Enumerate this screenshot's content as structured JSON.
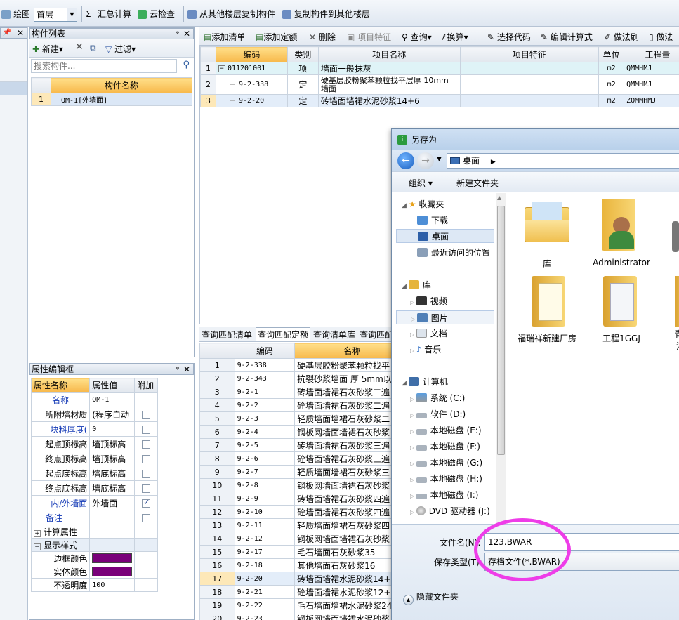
{
  "topbar": {
    "draw_label": "绘图",
    "floor": "首层",
    "sum_calc": "汇总计算",
    "cloud_check": "云检查",
    "copy_from": "从其他楼层复制构件",
    "copy_to": "复制构件到其他楼层"
  },
  "component_list": {
    "title": "构件列表",
    "new_label": "新建",
    "filter_label": "过滤",
    "search_placeholder": "搜索构件...",
    "col_name": "构件名称",
    "rows": [
      {
        "num": "1",
        "name": "QM-1[外墙面]"
      }
    ]
  },
  "quota_toolbar": {
    "add_list": "添加清单",
    "add_quota": "添加定额",
    "delete": "删除",
    "item_feature": "项目特征",
    "query": "查询",
    "convert": "换算",
    "select_code": "选择代码",
    "edit_formula": "编辑计算式",
    "method_brush": "做法刷",
    "method_q": "做法"
  },
  "quota_table": {
    "headers": [
      "编码",
      "类别",
      "项目名称",
      "项目特征",
      "单位",
      "工程量"
    ],
    "rows": [
      {
        "num": "1",
        "code": "011201001",
        "type": "项",
        "name": "墙面一般抹灰",
        "feature": "",
        "unit": "m2",
        "qty": "QMMHMJ"
      },
      {
        "num": "2",
        "code": "9-2-338",
        "type": "定",
        "name": "硬基层胶粉聚苯颗粒找平层厚 10mm 墙面",
        "feature": "",
        "unit": "m2",
        "qty": "QMMHMJ"
      },
      {
        "num": "3",
        "code": "9-2-20",
        "type": "定",
        "name": "砖墙面墙裙水泥砂浆14+6",
        "feature": "",
        "unit": "m2",
        "qty": "ZQMMHMJ"
      }
    ]
  },
  "query_tabs": [
    "查询匹配清单",
    "查询匹配定额",
    "查询清单库",
    "查询匹配"
  ],
  "query_table": {
    "headers": [
      "编码",
      "名称"
    ],
    "rows": [
      {
        "num": "1",
        "code": "9-2-338",
        "name": "硬基层胶粉聚苯颗粒找平"
      },
      {
        "num": "2",
        "code": "9-2-343",
        "name": "抗裂砂浆墙面 厚 5mm以内"
      },
      {
        "num": "3",
        "code": "9-2-1",
        "name": "砖墙面墙裙石灰砂浆二遍"
      },
      {
        "num": "4",
        "code": "9-2-2",
        "name": "砼墙面墙裙石灰砂浆二遍"
      },
      {
        "num": "5",
        "code": "9-2-3",
        "name": "轻质墙面墙裙石灰砂浆二"
      },
      {
        "num": "6",
        "code": "9-2-4",
        "name": "钢板网墙面墙裙石灰砂浆"
      },
      {
        "num": "7",
        "code": "9-2-5",
        "name": "砖墙面墙裙石灰砂浆三遍"
      },
      {
        "num": "8",
        "code": "9-2-6",
        "name": "砼墙面墙裙石灰砂浆三遍"
      },
      {
        "num": "9",
        "code": "9-2-7",
        "name": "轻质墙面墙裙石灰砂浆三"
      },
      {
        "num": "10",
        "code": "9-2-8",
        "name": "钢板网墙面墙裙石灰砂浆"
      },
      {
        "num": "11",
        "code": "9-2-9",
        "name": "砖墙面墙裙石灰砂浆四遍"
      },
      {
        "num": "12",
        "code": "9-2-10",
        "name": "砼墙面墙裙石灰砂浆四遍"
      },
      {
        "num": "13",
        "code": "9-2-11",
        "name": "轻质墙面墙裙石灰砂浆四"
      },
      {
        "num": "14",
        "code": "9-2-12",
        "name": "钢板网墙面墙裙石灰砂浆"
      },
      {
        "num": "15",
        "code": "9-2-17",
        "name": "毛石墙面石灰砂浆35"
      },
      {
        "num": "16",
        "code": "9-2-18",
        "name": "其他墙面石灰砂浆16"
      },
      {
        "num": "17",
        "code": "9-2-20",
        "name": "砖墙面墙裙水泥砂浆14+6"
      },
      {
        "num": "18",
        "code": "9-2-21",
        "name": "砼墙面墙裙水泥砂浆12+8"
      },
      {
        "num": "19",
        "code": "9-2-22",
        "name": "毛石墙面墙裙水泥砂浆24+"
      },
      {
        "num": "20",
        "code": "9-2-23",
        "name": "钢板网墙面墙裙水泥砂浆"
      }
    ]
  },
  "property_editor": {
    "title": "属性编辑框",
    "headers": [
      "属性名称",
      "属性值",
      "附加"
    ],
    "rows": [
      {
        "name": "名称",
        "value": "QM-1",
        "blue": true,
        "check": null
      },
      {
        "name": "所附墙材质",
        "value": "(程序自动",
        "blue": false,
        "check": false
      },
      {
        "name": "块料厚度(",
        "value": "0",
        "blue": true,
        "check": false
      },
      {
        "name": "起点顶标高",
        "value": "墙顶标高",
        "blue": false,
        "check": false
      },
      {
        "name": "终点顶标高",
        "value": "墙顶标高",
        "blue": false,
        "check": false
      },
      {
        "name": "起点底标高",
        "value": "墙底标高",
        "blue": false,
        "check": false
      },
      {
        "name": "终点底标高",
        "value": "墙底标高",
        "blue": false,
        "check": false
      },
      {
        "name": "内/外墙面",
        "value": "外墙面",
        "blue": true,
        "check": true
      },
      {
        "name": "备注",
        "value": "",
        "blue": true,
        "check": false
      }
    ],
    "group_calc": "计算属性",
    "group_display": "显示样式",
    "border_color_label": "边框颜色",
    "fill_color_label": "实体颜色",
    "opacity_label": "不透明度",
    "opacity_value": "100",
    "swatch_color": "#7a007a"
  },
  "dialog": {
    "title": "另存为",
    "location": "桌面",
    "organize": "组织",
    "new_folder": "新建文件夹",
    "tree": {
      "favorites": "收藏夹",
      "downloads": "下载",
      "desktop": "桌面",
      "recent": "最近访问的位置",
      "libraries": "库",
      "videos": "视频",
      "pictures": "图片",
      "documents": "文档",
      "music": "音乐",
      "computer": "计算机",
      "drive_c": "系统 (C:)",
      "drive_d": "软件 (D:)",
      "drive_e": "本地磁盘 (E:)",
      "drive_f": "本地磁盘 (F:)",
      "drive_g": "本地磁盘 (G:)",
      "drive_h": "本地磁盘 (H:)",
      "drive_i": "本地磁盘 (I:)",
      "drive_j": "DVD 驱动器 (J:)"
    },
    "files": [
      "库",
      "Administrator",
      "福瑞祥新建厂房",
      "工程1GGJ",
      "青",
      "沽"
    ],
    "filename_label": "文件名(N):",
    "filename_value": "123.BWAR",
    "filetype_label": "保存类型(T):",
    "filetype_value": "存档文件(*.BWAR)",
    "hide_folders": "隐藏文件夹"
  }
}
